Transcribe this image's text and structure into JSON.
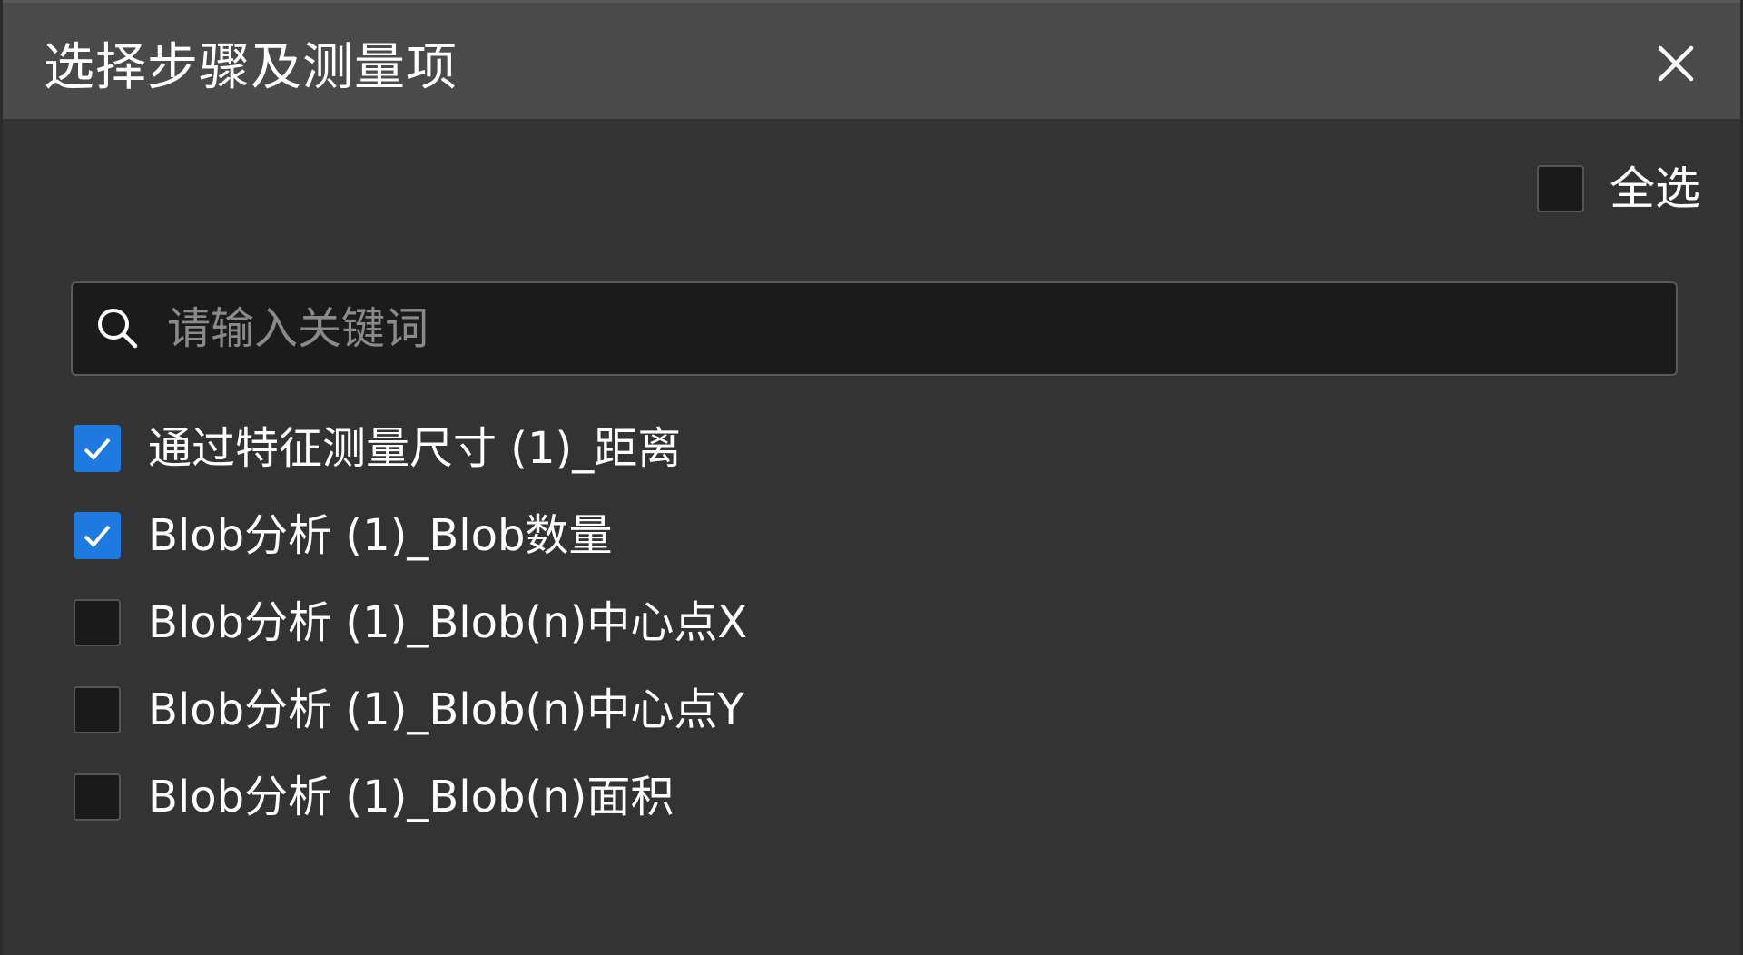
{
  "dialog": {
    "title": "选择步骤及测量项",
    "close_icon": "close-icon"
  },
  "select_all": {
    "label": "全选",
    "checked": false
  },
  "search": {
    "placeholder": "请输入关键词",
    "value": "",
    "icon": "search-icon"
  },
  "items": [
    {
      "label": "通过特征测量尺寸 (1)_距离",
      "checked": true
    },
    {
      "label": "Blob分析 (1)_Blob数量",
      "checked": true
    },
    {
      "label": "Blob分析 (1)_Blob(n)中心点X",
      "checked": false
    },
    {
      "label": "Blob分析 (1)_Blob(n)中心点Y",
      "checked": false
    },
    {
      "label": "Blob分析 (1)_Blob(n)面积",
      "checked": false
    }
  ],
  "colors": {
    "accent": "#1f7ae0",
    "titlebar": "#4a4a4a",
    "background": "#333333",
    "input_background": "#1b1b1b"
  }
}
